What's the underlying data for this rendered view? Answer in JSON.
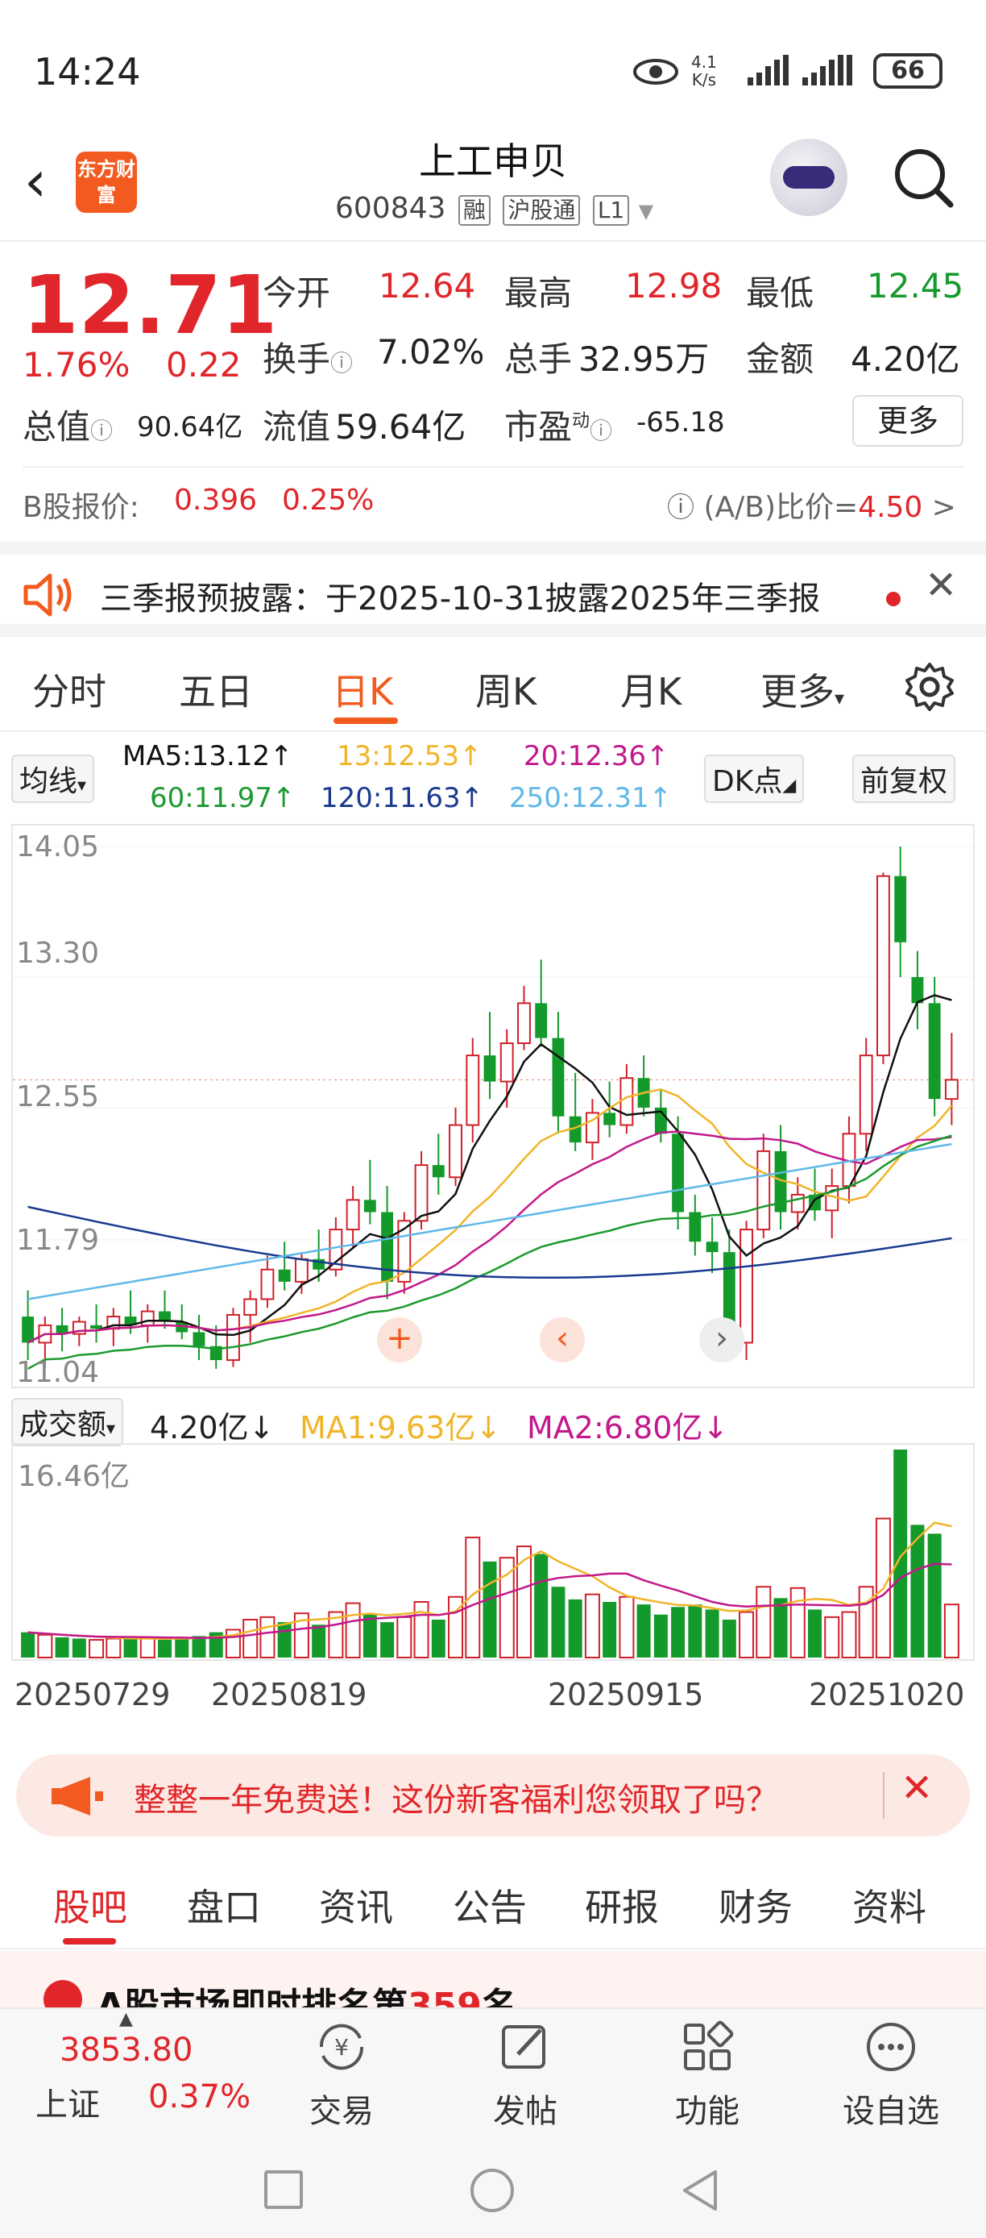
{
  "status_bar": {
    "time": "14:24",
    "net_speed_value": "4.1",
    "net_speed_unit": "K/s",
    "battery": "66"
  },
  "header": {
    "logo_text": "东方财富",
    "title": "上工申贝",
    "code": "600843",
    "tags": [
      "融",
      "沪股通",
      "L1"
    ],
    "icons": [
      "back-icon",
      "robot-avatar-icon",
      "search-icon"
    ]
  },
  "quote": {
    "price": "12.71",
    "change_pct": "1.76%",
    "change_amt": "0.22",
    "open_label": "今开",
    "open": "12.64",
    "high_label": "最高",
    "high": "12.98",
    "low_label": "最低",
    "low": "12.45",
    "turnover_label": "换手",
    "turnover": "7.02%",
    "volume_label": "总手",
    "volume": "32.95万",
    "amount_label": "金额",
    "amount": "4.20亿",
    "mktcap_label": "总值",
    "mktcap": "90.64亿",
    "float_label": "流值",
    "float_cap": "59.64亿",
    "pe_label": "市盈",
    "pe_sup": "动",
    "pe": "-65.18",
    "more_label": "更多",
    "b_label": "B股报价:",
    "b_price": "0.396",
    "b_pct": "0.25%",
    "ab_label": "(A/B)比价=",
    "ab_value": "4.50",
    "ab_arrow": ">"
  },
  "notice": {
    "text": "三季报预披露：于2025-10-31披露2025年三季报"
  },
  "chart_tabs": {
    "items": [
      "分时",
      "五日",
      "日K",
      "周K",
      "月K",
      "更多"
    ],
    "active": "日K"
  },
  "ma_bar": {
    "selector": "均线",
    "ma5": "MA5:13.12↑",
    "ma13": "13:12.53↑",
    "ma20": "20:12.36↑",
    "ma60": "60:11.97↑",
    "ma120": "120:11.63↑",
    "ma250": "250:12.31↑",
    "dk_label": "DK点",
    "adj_label": "前复权",
    "colors": {
      "ma5": "#111111",
      "ma13": "#f0b429",
      "ma20": "#c2188c",
      "ma60": "#1c9a2e",
      "ma120": "#1a3a8f",
      "ma250": "#5fb8e8"
    }
  },
  "volume_bar": {
    "selector": "成交额",
    "value": "4.20亿↓",
    "ma1": "MA1:9.63亿↓",
    "ma2": "MA2:6.80亿↓",
    "max_label": "16.46亿"
  },
  "dates": [
    "20250729",
    "20250819",
    "20250915",
    "20251020"
  ],
  "chart_data": [
    {
      "type": "candlestick",
      "y_ticks": [
        "14.05",
        "13.30",
        "12.55",
        "11.79",
        "11.04"
      ],
      "ylim": [
        11.04,
        14.05
      ],
      "candles": [
        {
          "o": 11.35,
          "h": 11.5,
          "l": 11.1,
          "c": 11.2
        },
        {
          "o": 11.2,
          "h": 11.35,
          "l": 11.05,
          "c": 11.3
        },
        {
          "o": 11.3,
          "h": 11.4,
          "l": 11.15,
          "c": 11.25
        },
        {
          "o": 11.25,
          "h": 11.35,
          "l": 11.18,
          "c": 11.32
        },
        {
          "o": 11.3,
          "h": 11.42,
          "l": 11.2,
          "c": 11.28
        },
        {
          "o": 11.28,
          "h": 11.4,
          "l": 11.18,
          "c": 11.35
        },
        {
          "o": 11.35,
          "h": 11.5,
          "l": 11.25,
          "c": 11.3
        },
        {
          "o": 11.3,
          "h": 11.42,
          "l": 11.2,
          "c": 11.38
        },
        {
          "o": 11.38,
          "h": 11.5,
          "l": 11.28,
          "c": 11.32
        },
        {
          "o": 11.32,
          "h": 11.42,
          "l": 11.22,
          "c": 11.26
        },
        {
          "o": 11.26,
          "h": 11.36,
          "l": 11.1,
          "c": 11.18
        },
        {
          "o": 11.18,
          "h": 11.3,
          "l": 11.05,
          "c": 11.1
        },
        {
          "o": 11.1,
          "h": 11.4,
          "l": 11.06,
          "c": 11.36
        },
        {
          "o": 11.36,
          "h": 11.5,
          "l": 11.2,
          "c": 11.45
        },
        {
          "o": 11.45,
          "h": 11.7,
          "l": 11.4,
          "c": 11.62
        },
        {
          "o": 11.62,
          "h": 11.78,
          "l": 11.5,
          "c": 11.55
        },
        {
          "o": 11.55,
          "h": 11.72,
          "l": 11.48,
          "c": 11.68
        },
        {
          "o": 11.68,
          "h": 11.85,
          "l": 11.55,
          "c": 11.62
        },
        {
          "o": 11.62,
          "h": 11.92,
          "l": 11.58,
          "c": 11.85
        },
        {
          "o": 11.85,
          "h": 12.1,
          "l": 11.75,
          "c": 12.02
        },
        {
          "o": 12.02,
          "h": 12.25,
          "l": 11.88,
          "c": 11.95
        },
        {
          "o": 11.95,
          "h": 12.1,
          "l": 11.45,
          "c": 11.55
        },
        {
          "o": 11.55,
          "h": 11.95,
          "l": 11.48,
          "c": 11.9
        },
        {
          "o": 11.9,
          "h": 12.3,
          "l": 11.85,
          "c": 12.22
        },
        {
          "o": 12.22,
          "h": 12.4,
          "l": 12.05,
          "c": 12.15
        },
        {
          "o": 12.15,
          "h": 12.55,
          "l": 12.1,
          "c": 12.45
        },
        {
          "o": 12.45,
          "h": 12.95,
          "l": 12.35,
          "c": 12.85
        },
        {
          "o": 12.85,
          "h": 13.1,
          "l": 12.6,
          "c": 12.7
        },
        {
          "o": 12.7,
          "h": 13.0,
          "l": 12.55,
          "c": 12.92
        },
        {
          "o": 12.92,
          "h": 13.25,
          "l": 12.88,
          "c": 13.15
        },
        {
          "o": 13.15,
          "h": 13.4,
          "l": 12.9,
          "c": 12.95
        },
        {
          "o": 12.95,
          "h": 13.1,
          "l": 12.4,
          "c": 12.5
        },
        {
          "o": 12.5,
          "h": 12.75,
          "l": 12.3,
          "c": 12.35
        },
        {
          "o": 12.35,
          "h": 12.6,
          "l": 12.25,
          "c": 12.52
        },
        {
          "o": 12.52,
          "h": 12.7,
          "l": 12.38,
          "c": 12.45
        },
        {
          "o": 12.45,
          "h": 12.8,
          "l": 12.4,
          "c": 12.72
        },
        {
          "o": 12.72,
          "h": 12.85,
          "l": 12.5,
          "c": 12.55
        },
        {
          "o": 12.55,
          "h": 12.65,
          "l": 12.35,
          "c": 12.4
        },
        {
          "o": 12.4,
          "h": 12.5,
          "l": 11.85,
          "c": 11.95
        },
        {
          "o": 11.95,
          "h": 12.05,
          "l": 11.7,
          "c": 11.78
        },
        {
          "o": 11.78,
          "h": 11.92,
          "l": 11.6,
          "c": 11.72
        },
        {
          "o": 11.72,
          "h": 11.85,
          "l": 11.12,
          "c": 11.2
        },
        {
          "o": 11.2,
          "h": 11.9,
          "l": 11.1,
          "c": 11.85
        },
        {
          "o": 11.85,
          "h": 12.4,
          "l": 11.8,
          "c": 12.3
        },
        {
          "o": 12.3,
          "h": 12.45,
          "l": 11.85,
          "c": 11.95
        },
        {
          "o": 11.95,
          "h": 12.15,
          "l": 11.85,
          "c": 12.05
        },
        {
          "o": 12.05,
          "h": 12.2,
          "l": 11.9,
          "c": 11.96
        },
        {
          "o": 11.96,
          "h": 12.2,
          "l": 11.8,
          "c": 12.1
        },
        {
          "o": 12.1,
          "h": 12.5,
          "l": 12.0,
          "c": 12.4
        },
        {
          "o": 12.4,
          "h": 12.95,
          "l": 12.3,
          "c": 12.85
        },
        {
          "o": 12.85,
          "h": 13.9,
          "l": 12.8,
          "c": 13.88
        },
        {
          "o": 13.88,
          "h": 14.05,
          "l": 13.3,
          "c": 13.5
        },
        {
          "o": 13.3,
          "h": 13.45,
          "l": 13.0,
          "c": 13.15
        },
        {
          "o": 13.15,
          "h": 13.3,
          "l": 12.5,
          "c": 12.6
        },
        {
          "o": 12.6,
          "h": 12.98,
          "l": 12.45,
          "c": 12.71
        }
      ]
    },
    {
      "type": "bar",
      "series_name": "成交额",
      "max": 16.46,
      "values": [
        2.0,
        1.8,
        1.6,
        1.5,
        1.4,
        1.5,
        1.6,
        1.5,
        1.4,
        1.5,
        1.7,
        2.0,
        2.2,
        3.0,
        3.2,
        2.8,
        3.5,
        2.6,
        3.6,
        4.3,
        3.4,
        2.8,
        3.2,
        4.4,
        3.0,
        4.8,
        9.5,
        7.6,
        7.9,
        8.8,
        8.2,
        5.6,
        4.6,
        5.0,
        4.4,
        4.8,
        4.2,
        3.4,
        4.0,
        4.2,
        3.8,
        3.0,
        3.6,
        5.6,
        4.7,
        5.5,
        3.8,
        3.2,
        3.6,
        5.6,
        11.0,
        16.46,
        10.5,
        9.8,
        4.2
      ],
      "up": [
        0,
        1,
        0,
        0,
        1,
        1,
        0,
        1,
        0,
        0,
        0,
        0,
        1,
        1,
        1,
        0,
        1,
        0,
        1,
        1,
        0,
        0,
        1,
        1,
        0,
        1,
        1,
        0,
        1,
        1,
        0,
        0,
        0,
        1,
        0,
        1,
        0,
        0,
        0,
        0,
        0,
        0,
        1,
        1,
        0,
        1,
        0,
        1,
        1,
        1,
        1,
        0,
        0,
        0,
        1
      ],
      "ma1_color": "#f0b429",
      "ma2_color": "#c2188c"
    }
  ],
  "promo": {
    "text": "整整一年免费送！这份新客福利您领取了吗？"
  },
  "content_tabs": {
    "items": [
      "股吧",
      "盘口",
      "资讯",
      "公告",
      "研报",
      "财务",
      "资料"
    ],
    "active": "股吧"
  },
  "teaser": {
    "text_prefix": "A股市场即时排名第",
    "rank": "359",
    "text_suffix": "名"
  },
  "bottom_bar": {
    "index_value": "3853.80",
    "index_name": "上证",
    "index_pct": "0.37%",
    "nav": [
      {
        "label": "交易",
        "icon": "trade-icon"
      },
      {
        "label": "发帖",
        "icon": "post-icon"
      },
      {
        "label": "功能",
        "icon": "functions-icon"
      },
      {
        "label": "设自选",
        "icon": "watchlist-icon"
      }
    ]
  }
}
